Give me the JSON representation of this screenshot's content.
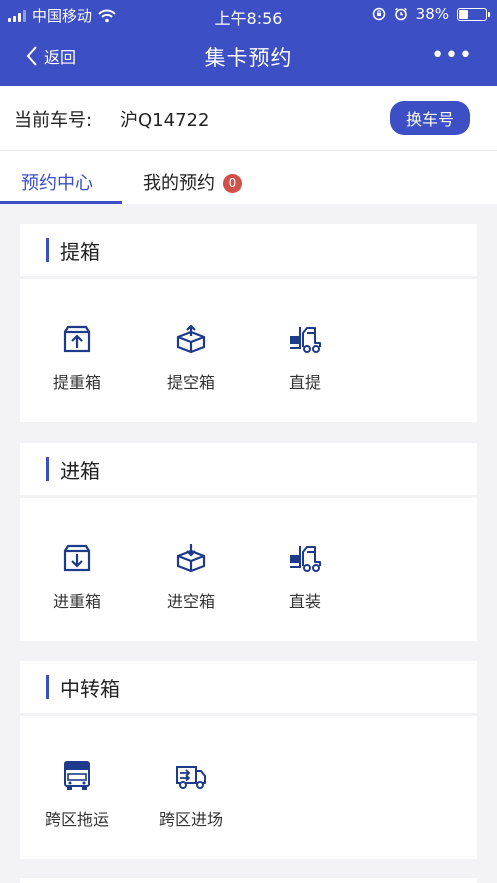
{
  "status": {
    "carrier": "中国移动",
    "time": "上午8:56",
    "battery": "38%",
    "battery_level": 0.38
  },
  "header": {
    "back_label": "返回",
    "title": "集卡预约",
    "more": "•••"
  },
  "plate": {
    "label": "当前车号:",
    "value": "沪Q14722",
    "change_label": "换车号"
  },
  "tabs": [
    {
      "label": "预约中心"
    },
    {
      "label": "我的预约",
      "badge": "0"
    }
  ],
  "sections": [
    {
      "title": "提箱",
      "items": [
        {
          "label": "提重箱",
          "icon": "box-up-icon"
        },
        {
          "label": "提空箱",
          "icon": "open-box-up-icon"
        },
        {
          "label": "直提",
          "icon": "forklift-icon"
        }
      ]
    },
    {
      "title": "进箱",
      "items": [
        {
          "label": "进重箱",
          "icon": "box-down-icon"
        },
        {
          "label": "进空箱",
          "icon": "open-box-down-icon"
        },
        {
          "label": "直装",
          "icon": "forklift-icon"
        }
      ]
    },
    {
      "title": "中转箱",
      "items": [
        {
          "label": "跨区拖运",
          "icon": "truck-front-icon"
        },
        {
          "label": "跨区进场",
          "icon": "truck-side-icon"
        }
      ]
    }
  ],
  "colors": {
    "primary": "#3c4fc5",
    "badge": "#d0504a",
    "icon": "#1e3a8a",
    "background": "#f3f3f5"
  }
}
